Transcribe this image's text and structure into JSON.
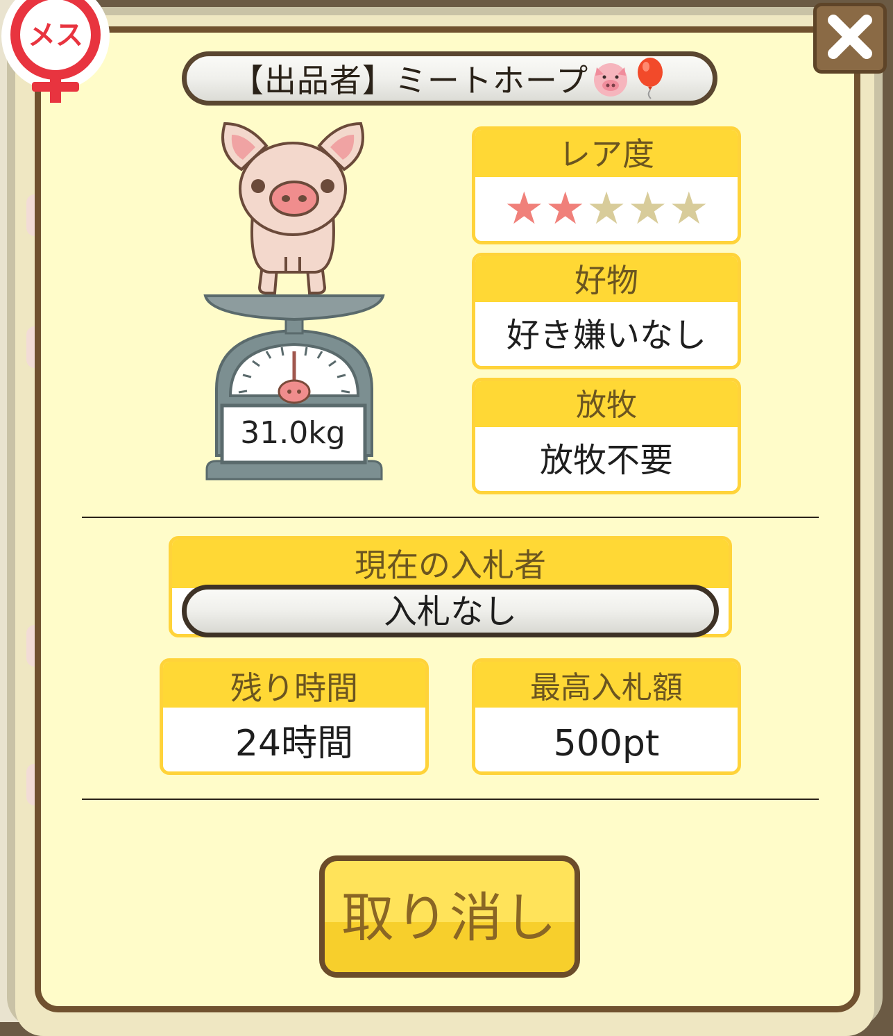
{
  "seller": {
    "label": "【出品者】ミートホープ",
    "icons": [
      "pig-face-icon",
      "balloon-icon"
    ]
  },
  "gender_badge": {
    "text": "メス",
    "symbol": "female-symbol-icon",
    "color": "#e8343f"
  },
  "pig": {
    "weight": "31.0kg"
  },
  "rarity": {
    "label": "レア度",
    "stars_total": 5,
    "stars_filled": 2,
    "filled_color": "#f0807a",
    "empty_color": "#d8cc9a"
  },
  "favorite_food": {
    "label": "好物",
    "value": "好き嫌いなし"
  },
  "grazing": {
    "label": "放牧",
    "value": "放牧不要"
  },
  "current_bidder": {
    "label": "現在の入札者",
    "value": "入札なし"
  },
  "remaining_time": {
    "label": "残り時間",
    "value": "24時間"
  },
  "highest_bid": {
    "label": "最高入札額",
    "value": "500pt"
  },
  "cancel_button": {
    "label": "取り消し"
  },
  "close_button": {
    "icon": "close-icon"
  },
  "colors": {
    "panel": "#fffcc9",
    "frame": "#70512f",
    "card_header": "#ffd835",
    "button": "#ffe35a"
  }
}
